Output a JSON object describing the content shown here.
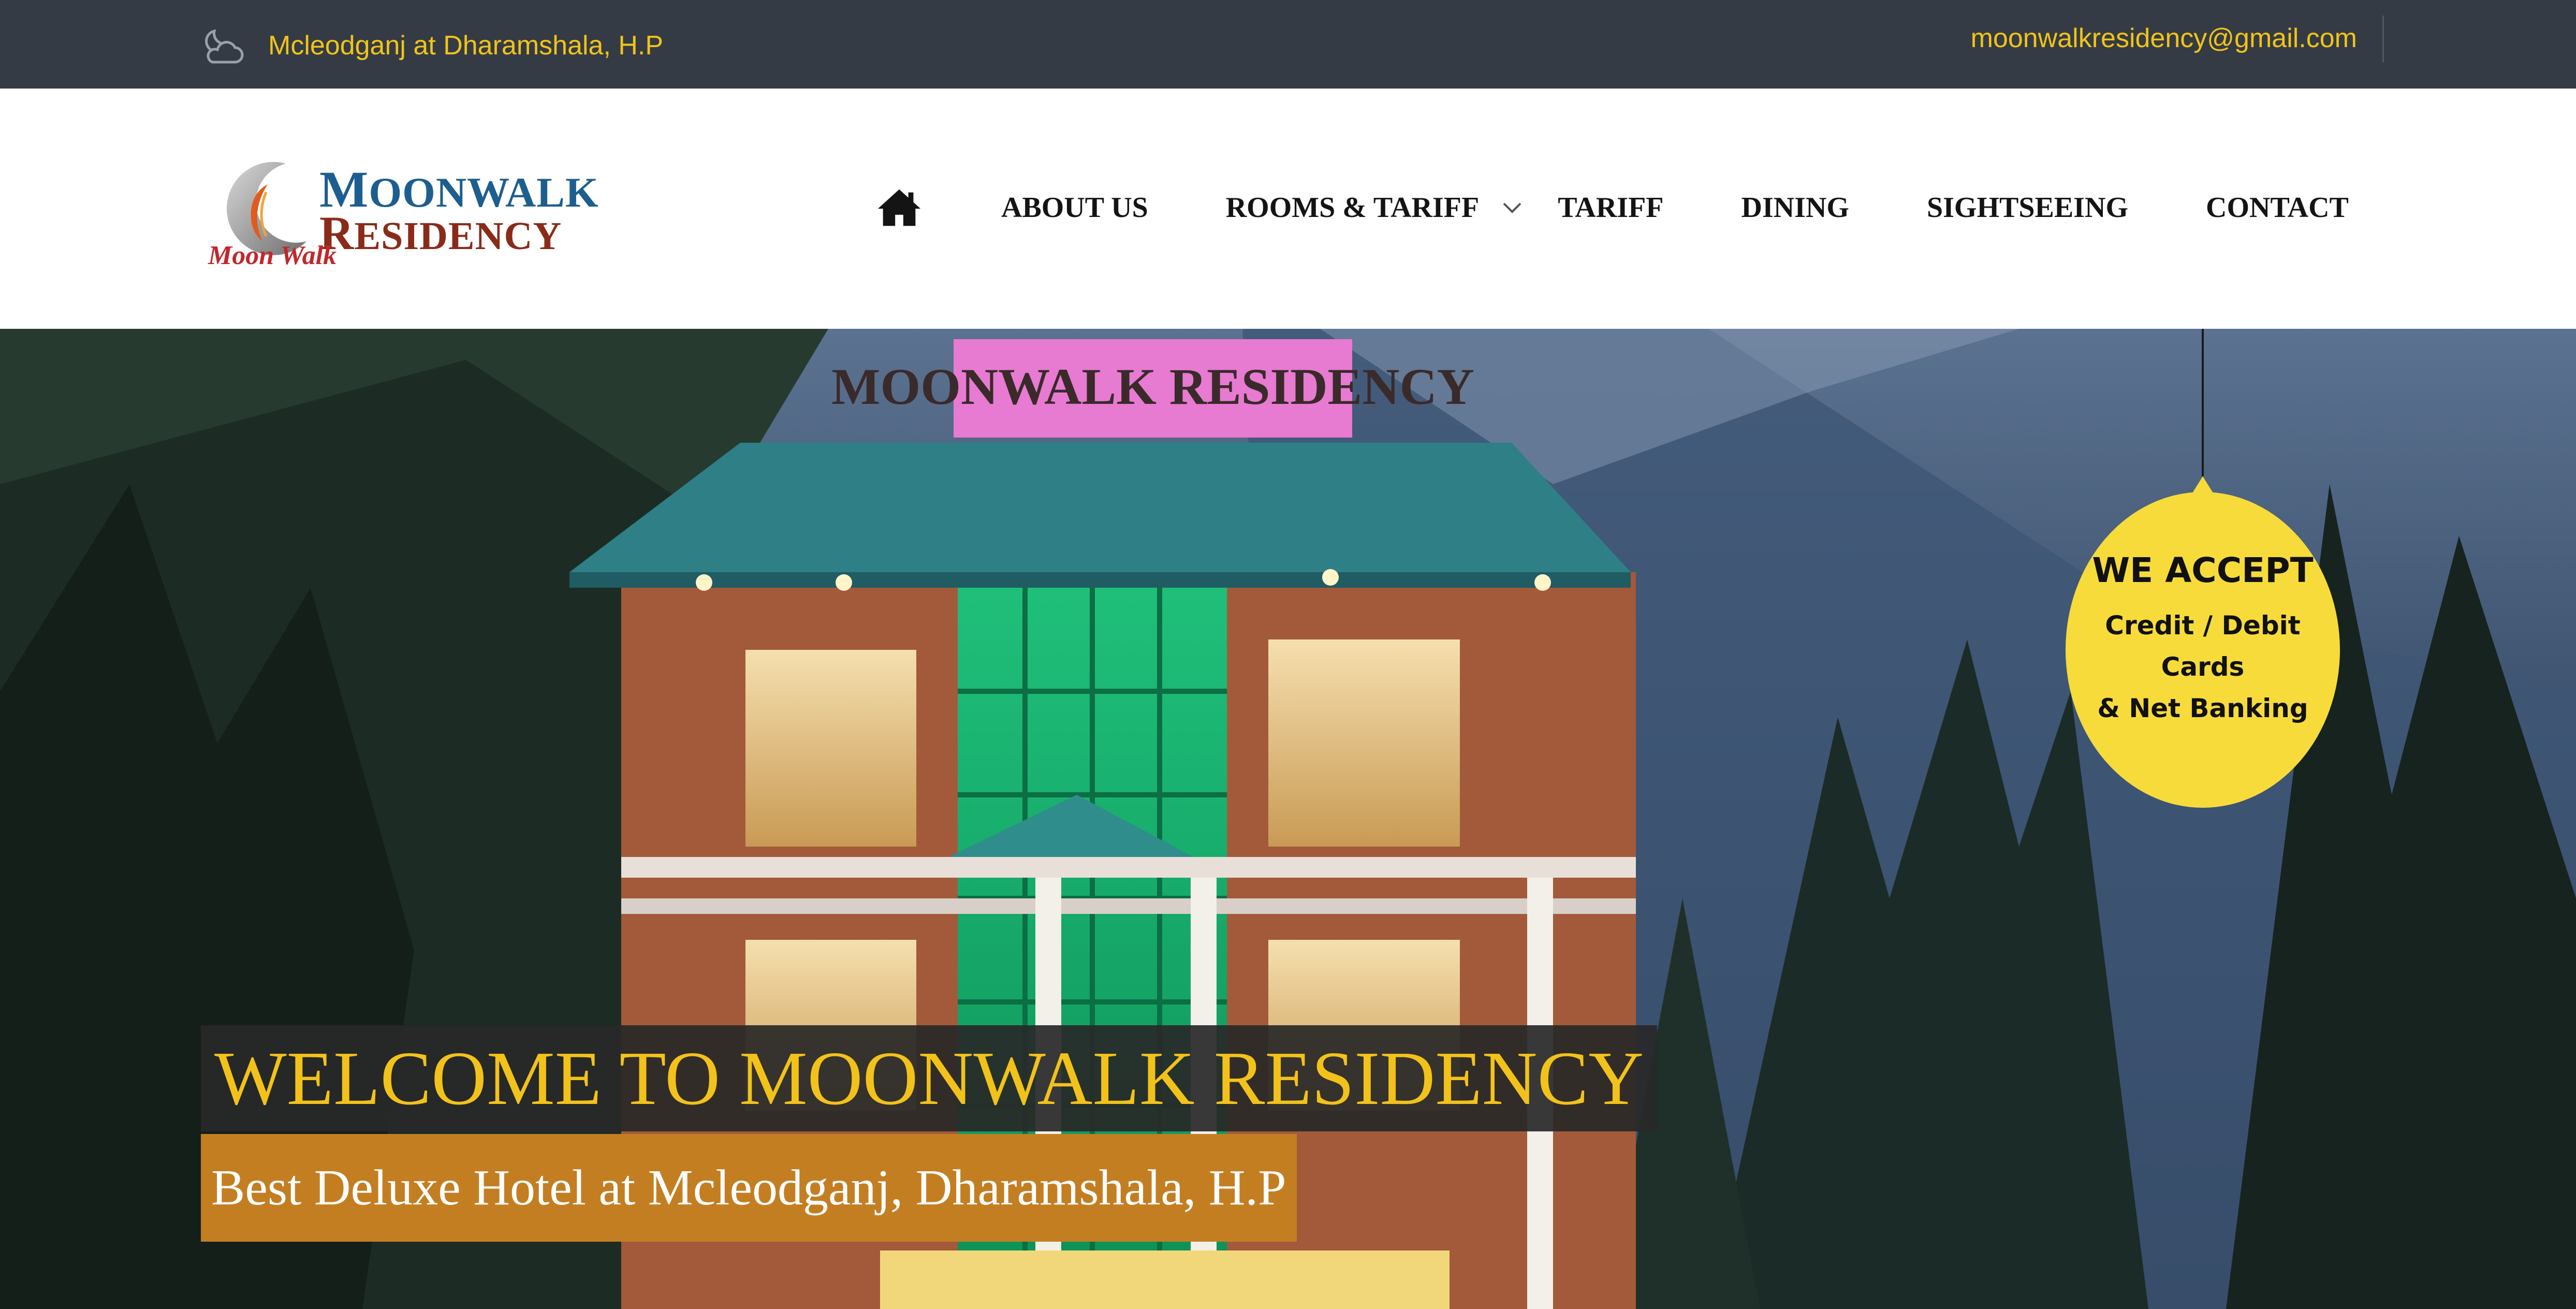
{
  "topbar": {
    "location": "Mcleodganj at Dharamshala, H.P",
    "location_icon": "cloud-moon-icon",
    "email": "moonwalkresidency@gmail.com"
  },
  "logo": {
    "line1_cap": "M",
    "line1_rest": "OONWALK",
    "line2_cap": "R",
    "line2_rest": "ESIDENCY",
    "script": "Moon Walk"
  },
  "nav": {
    "home_icon": "home-icon",
    "items": [
      "ABOUT US",
      "ROOMS & TARIFF",
      "TARIFF",
      "DINING",
      "SIGHTSEEING",
      "CONTACT"
    ]
  },
  "hero": {
    "building_sign": "MOONWALK RESIDENCY",
    "welcome": "WELCOME TO MOONWALK RESIDENCY",
    "tagline": "Best Deluxe Hotel at Mcleodganj, Dharamshala, H.P"
  },
  "badge": {
    "heading": "WE ACCEPT",
    "line1": "Credit / Debit Cards",
    "line2": "& Net Banking"
  },
  "colors": {
    "topbar_bg": "#353b45",
    "accent_yellow": "#f0c419",
    "tagline_bg": "#c47e22",
    "badge_yellow": "#f6db3b"
  }
}
